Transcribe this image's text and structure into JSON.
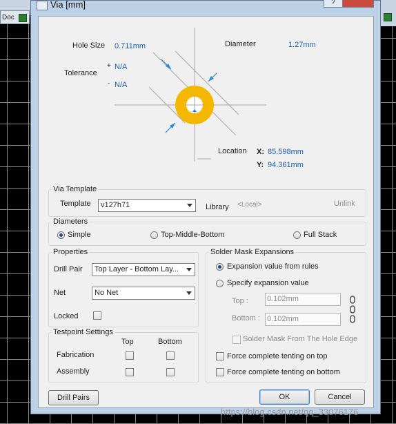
{
  "window": {
    "title": "Via [mm]",
    "help_glyph": "?",
    "background_tab": "Doc"
  },
  "diagram": {
    "hole_size_label": "Hole Size",
    "hole_size_value": "0.711mm",
    "tolerance_label": "Tolerance",
    "tol_plus_sign": "+",
    "tol_plus_value": "N/A",
    "tol_minus_sign": "-",
    "tol_minus_value": "N/A",
    "diameter_label": "Diameter",
    "diameter_value": "1.27mm",
    "location_label": "Location",
    "x_label": "X:",
    "x_value": "85.598mm",
    "y_label": "Y:",
    "y_value": "94.361mm",
    "pad_color": "#f5b800"
  },
  "via_template": {
    "group_title": "Via Template",
    "template_label": "Template",
    "template_value": "v127h71",
    "library_label": "Library",
    "library_value": "<Local>",
    "unlink_label": "Unlink"
  },
  "diameters": {
    "group_title": "Diameters",
    "options": [
      "Simple",
      "Top-Middle-Bottom",
      "Full Stack"
    ],
    "selected": "Simple"
  },
  "properties": {
    "group_title": "Properties",
    "drill_pair_label": "Drill Pair",
    "drill_pair_value": "Top Layer - Bottom Lay...",
    "net_label": "Net",
    "net_value": "No Net",
    "locked_label": "Locked"
  },
  "testpoint": {
    "group_title": "Testpoint Settings",
    "col_top": "Top",
    "col_bottom": "Bottom",
    "row_fabrication": "Fabrication",
    "row_assembly": "Assembly"
  },
  "solder_mask": {
    "group_title": "Solder Mask Expansions",
    "opt_rules": "Expansion value from rules",
    "opt_specify": "Specify expansion value",
    "top_label": "Top :",
    "top_value": "0.102mm",
    "bottom_label": "Bottom :",
    "bottom_value": "0.102mm",
    "from_hole_edge": "Solder Mask From The Hole Edge",
    "tent_top": "Force complete tenting on top",
    "tent_bottom": "Force complete tenting on bottom"
  },
  "buttons": {
    "drill_pairs": "Drill Pairs",
    "ok": "OK",
    "cancel": "Cancel"
  },
  "watermark": "https://blog.csdn.net/qq_33076176"
}
